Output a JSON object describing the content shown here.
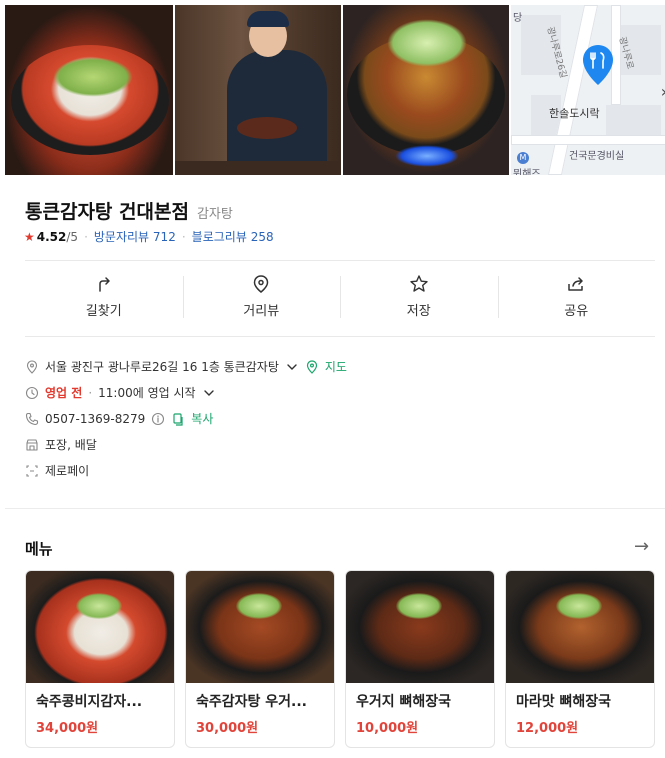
{
  "photos": [
    {
      "icon": "food-photo-kongbiji-gamjatang"
    },
    {
      "icon": "chef-photo"
    },
    {
      "icon": "food-photo-gamjatang-pot"
    },
    {
      "icon": "map-thumbnail"
    }
  ],
  "map": {
    "place_label": "한솔도시락",
    "landmark_label": "건국문경비실",
    "road_label_1": "광나루로26길",
    "road_label_2": "광나루로",
    "station_label_fragment": "뮈해즈",
    "next_arrow": "›",
    "top_label": "당"
  },
  "place": {
    "name": "통큰감자탕 건대본점",
    "category": "감자탕",
    "star": "★",
    "rating": "4.52",
    "rating_total": "/5",
    "visitor_review_label": "방문자리뷰",
    "visitor_review_count": "712",
    "blog_review_label": "블로그리뷰",
    "blog_review_count": "258",
    "separator": "·"
  },
  "actions": [
    {
      "label": "길찾기",
      "icon": "directions-icon"
    },
    {
      "label": "거리뷰",
      "icon": "location-pin-icon"
    },
    {
      "label": "저장",
      "icon": "star-icon"
    },
    {
      "label": "공유",
      "icon": "share-icon"
    }
  ],
  "info": {
    "address": "서울 광진구 광나루로26길 16 1층 통큰감자탕",
    "map_link": "지도",
    "hours_status": "영업 전",
    "hours_detail": "11:00에 영업 시작",
    "phone": "0507-1369-8279",
    "copy_label": "복사",
    "options": "포장, 배달",
    "payment": "제로페이"
  },
  "menu": {
    "title": "메뉴",
    "more_arrow": "→",
    "items": [
      {
        "name": "숙주콩비지감자...",
        "price": "34,000원"
      },
      {
        "name": "숙주감자탕 우거...",
        "price": "30,000원"
      },
      {
        "name": "우거지 뼈해장국",
        "price": "10,000원"
      },
      {
        "name": "마라맛 뼈해장국",
        "price": "12,000원"
      }
    ]
  },
  "colors": {
    "accent_green": "#1aa56b",
    "accent_red": "#e23a2e",
    "link_blue": "#2a64b8",
    "price_red": "#e0443a",
    "map_pin_blue": "#1e88f0"
  }
}
